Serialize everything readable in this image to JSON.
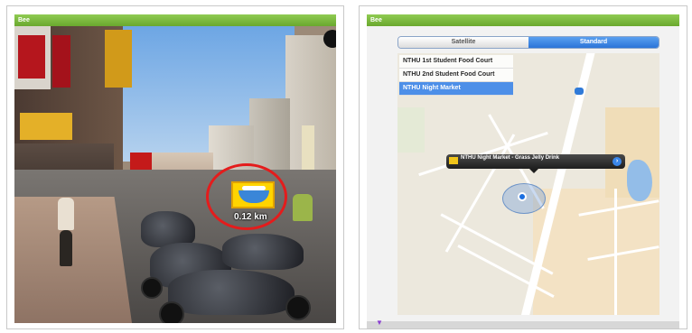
{
  "left_screen": {
    "app_title": "Bee",
    "ar_marker": {
      "distance": "0.12 km",
      "icon": "food-stall-icon"
    }
  },
  "right_screen": {
    "app_title": "Bee",
    "map_mode_tabs": [
      {
        "label": "Satellite",
        "selected": false
      },
      {
        "label": "Standard",
        "selected": true
      }
    ],
    "poi_list": [
      {
        "label": "NTHU 1st Student Food Court",
        "selected": false
      },
      {
        "label": "NTHU 2nd Student Food Court",
        "selected": false
      },
      {
        "label": "NTHU Night Market",
        "selected": true
      }
    ],
    "callout": {
      "title": "NTHU Night Market - Grass Jelly Drink",
      "info_icon": "info-disclosure-icon"
    }
  },
  "colors": {
    "app_bar": "#7ab63b",
    "ar_ring": "#e41c1c",
    "ar_icon_bg": "#ffd400",
    "segment_active": "#2b74d8",
    "list_selected": "#4d8fe8",
    "user_location": "#1c6fe0"
  }
}
